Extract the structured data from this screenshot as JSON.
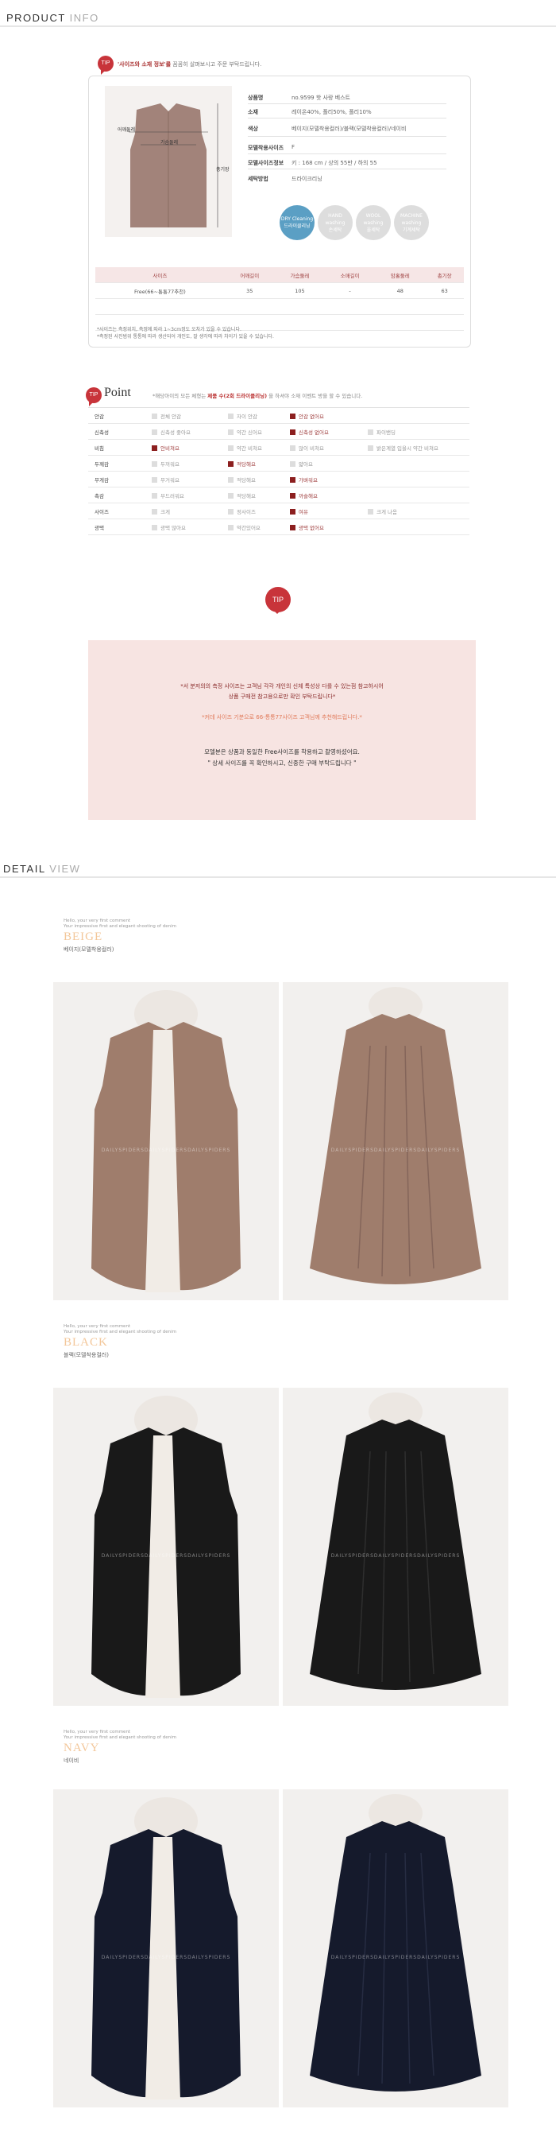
{
  "product_info": {
    "title_a": "PRODUCT",
    "title_b": "INFO",
    "tip_badge": "TIP",
    "tip_title": "'사이즈와 소재 정보'를",
    "tip_text": "꼼꼼히 살펴보시고 주문 부탁드립니다.",
    "diagram": {
      "shoulder": "어깨둘레",
      "chest": "가슴둘레",
      "length": "총기장"
    },
    "specs": [
      {
        "key": "상품명",
        "value": "no.9599 핫 사랑 베스트"
      },
      {
        "key": "소재",
        "value": "레이온40%, 폴리50%, 폴리10%"
      },
      {
        "key": "색상",
        "value": "베이지(모델착용컬러)/블랙(모델착용컬러)/네이비"
      },
      {
        "key": "모델착용사이즈",
        "value": "F"
      },
      {
        "key": "모델사이즈정보",
        "value": "키 : 168 cm / 상의 55반 / 하의 55"
      },
      {
        "key": "세탁방법",
        "value": "드라이크리닝"
      }
    ],
    "care": [
      {
        "en": "DRY Cleaning",
        "ko": "드라이클리닝",
        "on": true
      },
      {
        "en": "HAND washing",
        "ko": "손세탁",
        "on": false
      },
      {
        "en": "WOOL washing",
        "ko": "울세탁",
        "on": false
      },
      {
        "en": "MACHINE washing",
        "ko": "기계세탁",
        "on": false
      }
    ],
    "size_headers": [
      "사이즈",
      "어깨길이",
      "가슴둘레",
      "소매길이",
      "암홀둘레",
      "총기장"
    ],
    "size_rows": [
      [
        "Free(66~통통77추천)",
        "35",
        "105",
        "-",
        "48",
        "63"
      ]
    ],
    "notes": [
      "*사이즈는 측정위치, 측정에 따라 1~3cm정도 오차가 있을 수 있습니다.",
      "*측정된 사진범위 통통에 따라 생산되어 개인도, 잘 생각에 따라 차이가 있을 수 있습니다."
    ]
  },
  "point": {
    "badge": "TIP",
    "title": "Point",
    "desc_a": "*해당아이의 모든 체형는",
    "desc_hl": "제품 수(2회 드라이클리닝)",
    "desc_b": "을 하셔야 소재 이벤트 방을 할 수 있습니다.",
    "rows": [
      {
        "label": "안감",
        "opts": [
          {
            "t": "전체 안감",
            "s": false
          },
          {
            "t": "자이 안감",
            "s": false
          },
          {
            "t": "안감 없어요",
            "s": true
          }
        ]
      },
      {
        "label": "신축성",
        "opts": [
          {
            "t": "신축성 좋아요",
            "s": false
          },
          {
            "t": "약간 신어요",
            "s": false
          },
          {
            "t": "신축성 없어요",
            "s": true
          },
          {
            "t": "파이밴딩",
            "s": false
          }
        ]
      },
      {
        "label": "비침",
        "opts": [
          {
            "t": "안비쳐요",
            "s": true
          },
          {
            "t": "약간 비쳐요",
            "s": false
          },
          {
            "t": "많이 비쳐요",
            "s": false
          },
          {
            "t": "밝은계열 입을시 약간 비쳐요",
            "s": false
          }
        ]
      },
      {
        "label": "두께감",
        "opts": [
          {
            "t": "두꺼워요",
            "s": false
          },
          {
            "t": "적당해요",
            "s": true
          },
          {
            "t": "얇아요",
            "s": false
          }
        ]
      },
      {
        "label": "무게감",
        "opts": [
          {
            "t": "무거워요",
            "s": false
          },
          {
            "t": "적당해요",
            "s": false
          },
          {
            "t": "가벼워요",
            "s": true
          }
        ]
      },
      {
        "label": "촉감",
        "opts": [
          {
            "t": "부드러워요",
            "s": false
          },
          {
            "t": "적당해요",
            "s": false
          },
          {
            "t": "까슬해요",
            "s": true
          }
        ]
      },
      {
        "label": "사이즈",
        "opts": [
          {
            "t": "크게",
            "s": false
          },
          {
            "t": "정사이즈",
            "s": false
          },
          {
            "t": "여유",
            "s": true
          },
          {
            "t": "크게 나옴",
            "s": false
          }
        ]
      },
      {
        "label": "광택",
        "opts": [
          {
            "t": "광택 많아요",
            "s": false
          },
          {
            "t": "약간있어요",
            "s": false
          },
          {
            "t": "광택 없어요",
            "s": true
          }
        ]
      }
    ]
  },
  "tip_box": {
    "badge": "TIP",
    "line1": "*서 분저의의 측정 사이즈는 고객님 각각 개인의 신체 특성상 다를 수 있는점 참고하시어",
    "line2": "상품 구매전 참고용으로만 확인 부탁드립니다*",
    "line3": "*커데 사이즈 기분으로 66-통통77사이즈 고객님께 추천해드립니다.*",
    "line4": "모델분은 상품과 동일한 Free사이즈를 착용하고 촬영하셨어요.",
    "line5": "\" 상세 사이즈를 꼭 확인하시고, 신중한 구매 부탁드립니다 \""
  },
  "detail": {
    "title_a": "DETAIL",
    "title_b": "VIEW",
    "colors": [
      {
        "en1": "Hello, your very first comment",
        "en2": "Your impressive first and elegant shooting of denim",
        "big": "BEIGE",
        "ko": "베이지(모델착용컬러)",
        "tone": "#9f7d6c",
        "watermark": "DAILYSPIDERSDAILYSPIDERSDAILYSPIDERS"
      },
      {
        "en1": "Hello, your very first comment",
        "en2": "Your impressive first and elegant shooting of denim",
        "big": "BLACK",
        "ko": "블랙(모델착용컬러)",
        "tone": "#191919",
        "watermark": "DAILYSPIDERSDAILYSPIDERSDAILYSPIDERS"
      },
      {
        "en1": "Hello, your very first comment",
        "en2": "Your impressive first and elegant shooting of denim",
        "big": "NAVY",
        "ko": "네이비",
        "tone": "#151a2c",
        "watermark": "DAILYSPIDERSDAILYSPIDERSDAILYSPIDERS"
      }
    ]
  }
}
